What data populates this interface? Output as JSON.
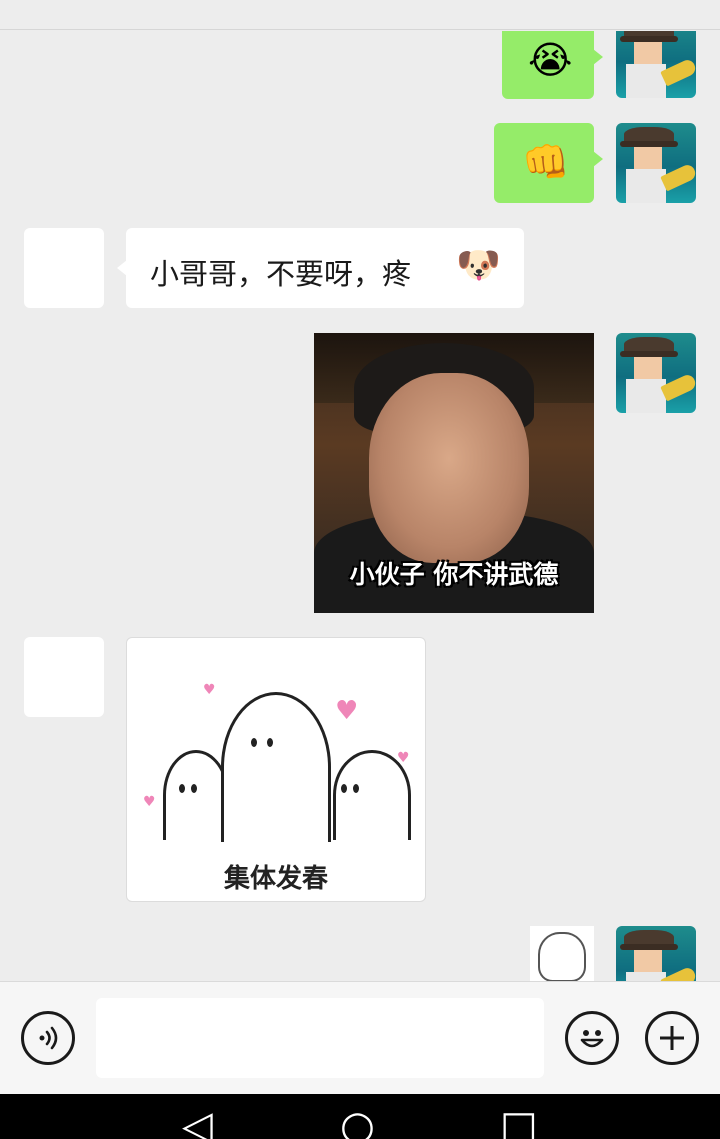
{
  "messages": {
    "m1": {
      "emoji": "😭"
    },
    "m2": {
      "emoji": "👊"
    },
    "m3": {
      "text": "小哥哥，不要呀，疼",
      "emoji": "🐶"
    },
    "m4": {
      "caption": "小伙子 你不讲武德"
    },
    "m5": {
      "caption": "集体发春"
    }
  },
  "input_bar": {
    "voice_icon": "voice-icon",
    "emoji_icon": "emoji-icon",
    "plus_icon": "plus-icon",
    "text_value": ""
  },
  "nav_bar": {
    "back_glyph": "◁",
    "home_glyph": "○",
    "recent_glyph": "□"
  },
  "colors": {
    "sent_bubble": "#95ec69",
    "received_bubble": "#ffffff",
    "background": "#ededed"
  }
}
